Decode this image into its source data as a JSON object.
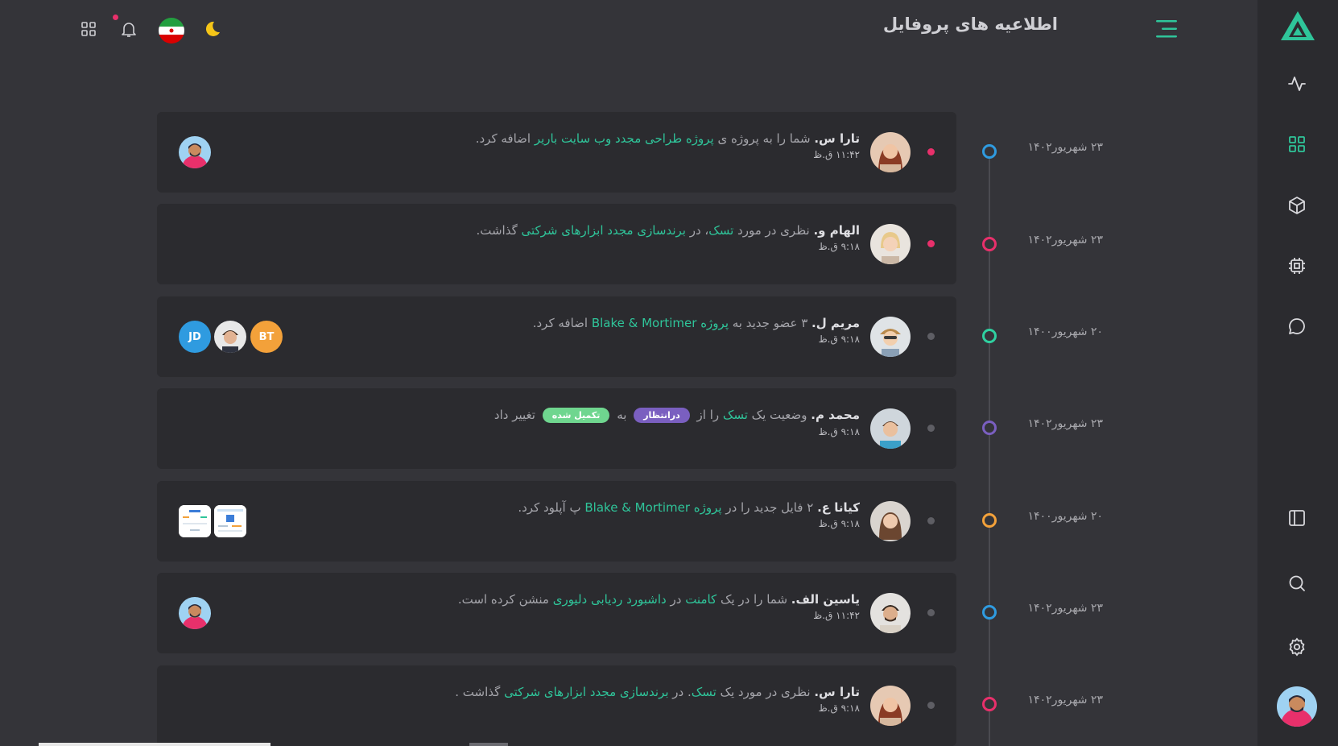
{
  "header": {
    "title": "اطلاعیه های پروفایل"
  },
  "sidebar": {
    "items": [
      {
        "icon": "activity-icon"
      },
      {
        "icon": "grid-icon",
        "active": true
      },
      {
        "icon": "box-icon"
      },
      {
        "icon": "chip-icon"
      },
      {
        "icon": "chat-icon"
      },
      {
        "icon": "panel-icon"
      },
      {
        "icon": "search-icon"
      },
      {
        "icon": "settings-icon"
      }
    ]
  },
  "colors": {
    "accent": "#2fc59a",
    "pink": "#e8306b",
    "blue": "#2f9be0",
    "purple": "#7a5fc0",
    "orange": "#f3a13a",
    "teal": "#2fd0a0"
  },
  "timeline": [
    {
      "date": "۲۳ شهریور۱۴۰۲",
      "color": "#2f9be0"
    },
    {
      "date": "۲۳ شهریور۱۴۰۲",
      "color": "#e8306b"
    },
    {
      "date": "۲۰ شهریور۱۴۰۰",
      "color": "#2fd0a0"
    },
    {
      "date": "۲۳ شهریور۱۴۰۲",
      "color": "#7a5fc0"
    },
    {
      "date": "۲۰ شهریور۱۴۰۰",
      "color": "#f3a13a"
    },
    {
      "date": "۲۳ شهریور۱۴۰۲",
      "color": "#2f9be0"
    },
    {
      "date": "۲۳ شهریور۱۴۰۲",
      "color": "#e8306b"
    }
  ],
  "activities": [
    {
      "name": "تارا س.",
      "pre": " شما را به پروژه ی ",
      "link": "پروژه طراحی مجدد وب سایت باریر",
      "post": " اضافه کرد.",
      "time": "۱۱:۴۲ ق.ظ"
    },
    {
      "name": "الهام و.",
      "pre": " نظری در مورد ",
      "link": "تسک",
      "mid": "، در ",
      "link2": "برندسازی مجدد ابزارهای شرکتی",
      "post": " گذاشت.",
      "time": "۹:۱۸ ق.ظ"
    },
    {
      "name": "مریم ل.",
      "pre": " ۳ عضو جدید به ",
      "link": "پروژه Blake & Mortimer",
      "post": " اضافه کرد.",
      "time": "۹:۱۸ ق.ظ",
      "members": [
        "BT",
        "JD"
      ]
    },
    {
      "name": "محمد م.",
      "pre": " وضعیت یک ",
      "link": "تسک",
      "mid": " را از ",
      "pill_from": "درانتظار",
      "mid2": " به ",
      "pill_to": "تکمیل شده",
      "post": " تغییر داد",
      "time": "۹:۱۸ ق.ظ"
    },
    {
      "name": "کیانا ع.",
      "pre": " ۲ فایل جدید را در ",
      "link": "پروژه Blake & Mortimer",
      "post": " پ آپلود کرد.",
      "time": "۹:۱۸ ق.ظ"
    },
    {
      "name": "یاسین الف.",
      "pre": " شما را در یک ",
      "link": "کامنت",
      "mid": " در ",
      "link2": "داشبورد ردیابی دلیوری",
      "post": " منشن کرده است.",
      "time": "۱۱:۴۲ ق.ظ"
    },
    {
      "name": "تارا س.",
      "pre": " نظری در مورد یک ",
      "link": "تسک",
      "mid": ". در ",
      "link2": "برندسازی مجدد ابزارهای شرکتی",
      "post": " گذاشت .",
      "time": "۹:۱۸ ق.ظ"
    }
  ]
}
